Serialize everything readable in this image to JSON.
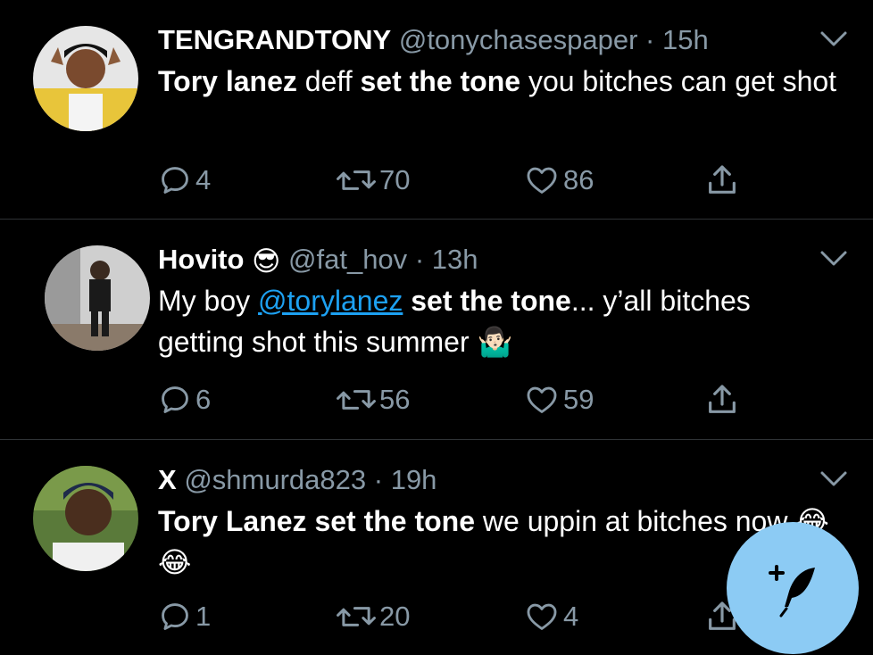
{
  "tweets": [
    {
      "name": "TENGRANDTONY",
      "handle": "@tonychasespaper",
      "separator": "·",
      "time": "15h",
      "body": [
        {
          "text": "Tory lanez",
          "bold": true
        },
        {
          "text": " deff ",
          "bold": false
        },
        {
          "text": "set the tone",
          "bold": true
        },
        {
          "text": " you bitches can get shot",
          "bold": false
        }
      ],
      "replies": "4",
      "retweets": "70",
      "likes": "86",
      "avatar_icon": "person-avatar"
    },
    {
      "name": "Hovito",
      "name_emoji": "😎",
      "handle": "@fat_hov",
      "separator": "·",
      "time": "13h",
      "body_prefix": "My boy ",
      "mention": "@torylanez",
      "body_bold": " set the tone",
      "body_suffix": "... y’all bitches getting shot this summer ",
      "body_emoji": "🤷🏻‍♂️",
      "replies": "6",
      "retweets": "56",
      "likes": "59",
      "avatar_icon": "person-avatar"
    },
    {
      "name": "X",
      "handle": "@shmurda823",
      "separator": "·",
      "time": "19h",
      "body_bold": "Tory Lanez set the tone",
      "body_suffix": " we uppin at bitches now ",
      "body_emoji": "😂😂",
      "replies": "1",
      "retweets": "20",
      "likes": "4",
      "avatar_icon": "person-avatar"
    }
  ],
  "fab": {
    "icon": "compose-tweet-icon"
  },
  "colors": {
    "background": "#000000",
    "secondary_text": "#8899a6",
    "link": "#1da1f2",
    "fab": "#8ccbf4",
    "divider": "#2f3336"
  }
}
